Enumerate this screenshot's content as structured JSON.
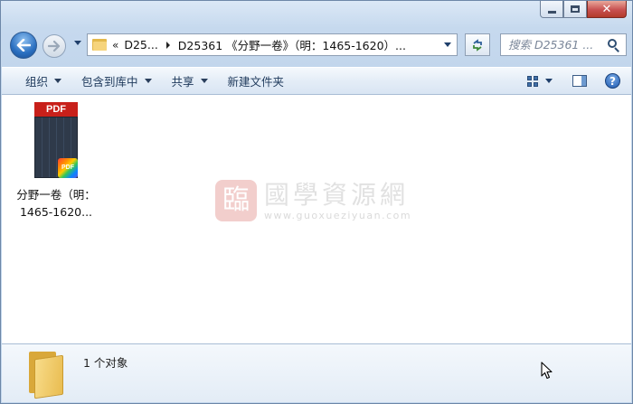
{
  "window": {
    "minimize_label": "",
    "close_glyph": "✕"
  },
  "nav": {
    "breadcrumb_prefix": "«",
    "breadcrumb": [
      "D25...",
      "D25361 《分野一卷》（明：1465-1620）..."
    ],
    "search_placeholder": "搜索 D25361 ...",
    "icons": [
      "back-arrow-icon",
      "forward-arrow-icon",
      "folder-icon",
      "refresh-icon",
      "search-icon"
    ]
  },
  "toolbar": {
    "organize": "组织",
    "include_in_library": "包含到库中",
    "share": "共享",
    "new_folder": "新建文件夹",
    "help_glyph": "?"
  },
  "content": {
    "file": {
      "thumb_label": "PDF",
      "badge_label": "PDF",
      "name_line1": "分野一卷（明：",
      "name_line2": "1465-1620..."
    },
    "watermark": {
      "seal_char": "臨",
      "title": "國學資源網",
      "url": "www.guoxueziyuan.com"
    }
  },
  "status": {
    "item_count": "1 个对象"
  },
  "colors": {
    "accent_blue": "#2a6fc0",
    "pdf_red": "#c8201a",
    "folder_yellow": "#f6d47c"
  }
}
